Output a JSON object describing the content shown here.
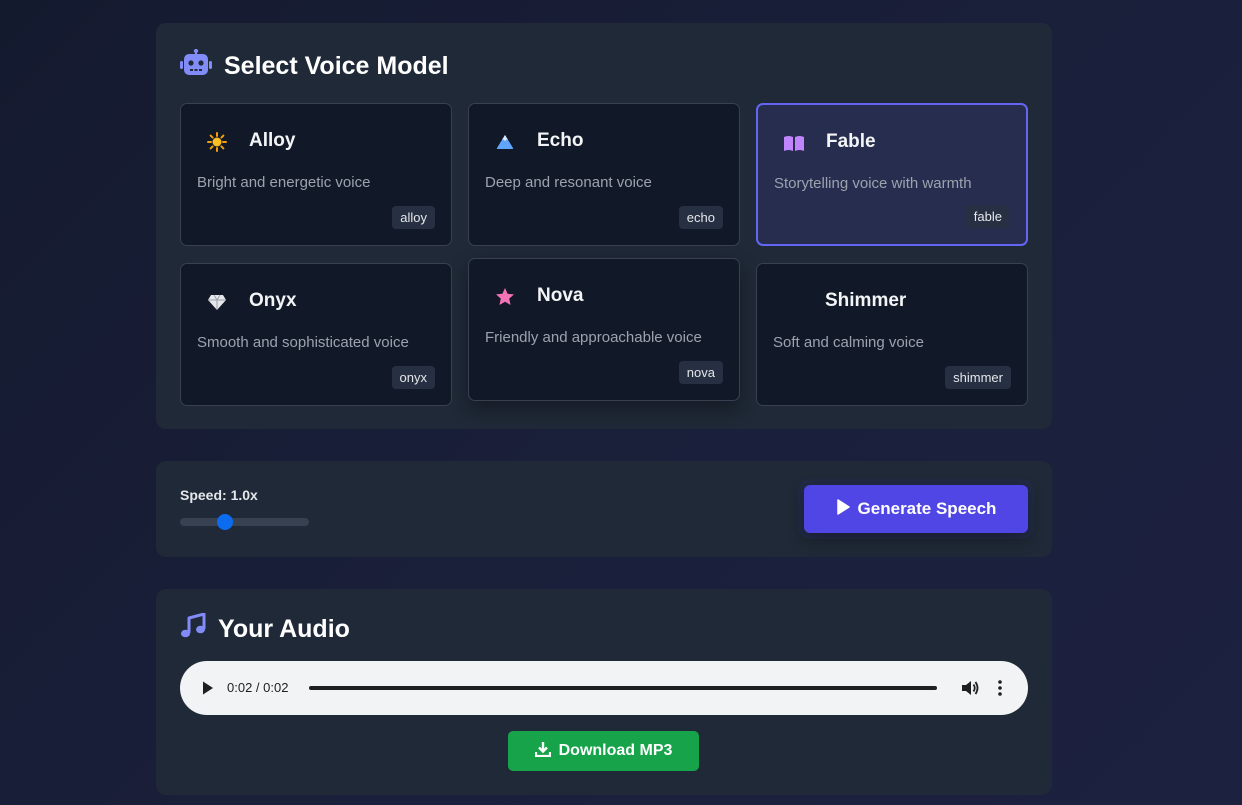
{
  "voice_section": {
    "title": "Select Voice Model",
    "icon": "robot-icon"
  },
  "voices": [
    {
      "name": "Alloy",
      "description": "Bright and energetic voice",
      "tag": "alloy",
      "icon": "sun-icon",
      "icon_color": "#f59e0b",
      "selected": false
    },
    {
      "name": "Echo",
      "description": "Deep and resonant voice",
      "tag": "echo",
      "icon": "mountain-icon",
      "icon_color": "#60a5fa",
      "selected": false
    },
    {
      "name": "Fable",
      "description": "Storytelling voice with warmth",
      "tag": "fable",
      "icon": "book-icon",
      "icon_color": "#c084fc",
      "selected": true
    },
    {
      "name": "Onyx",
      "description": "Smooth and sophisticated voice",
      "tag": "onyx",
      "icon": "gem-icon",
      "icon_color": "#e5e7eb",
      "selected": false
    },
    {
      "name": "Nova",
      "description": "Friendly and approachable voice",
      "tag": "nova",
      "icon": "star-icon",
      "icon_color": "#f472b6",
      "selected": false
    },
    {
      "name": "Shimmer",
      "description": "Soft and calming voice",
      "tag": "shimmer",
      "icon": "",
      "icon_color": "",
      "selected": false
    }
  ],
  "controls": {
    "speed_label": "Speed: 1.0x",
    "speed_fraction": 0.35,
    "generate_label": "Generate Speech"
  },
  "audio_section": {
    "title": "Your Audio",
    "icon": "music-note-icon",
    "player_time": "0:02 / 0:02",
    "download_label": "Download MP3"
  },
  "colors": {
    "accent": "#4f46e5",
    "download": "#16a34a",
    "selected_border": "#6366f1"
  }
}
